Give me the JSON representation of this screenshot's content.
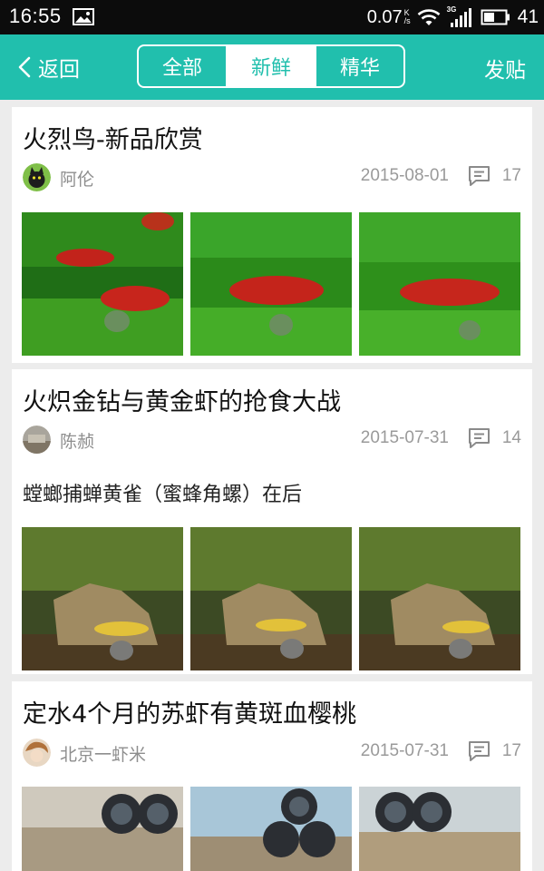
{
  "status_bar": {
    "time": "16:55",
    "speed": "0.07",
    "speed_unit_top": "K",
    "speed_unit_bottom": "/s",
    "network_type": "3G",
    "battery": "41",
    "icons": [
      "image-icon",
      "wifi-icon",
      "signal-icon",
      "battery-icon"
    ]
  },
  "header": {
    "back_label": "返回",
    "tabs": [
      {
        "label": "全部",
        "active": false
      },
      {
        "label": "新鲜",
        "active": true
      },
      {
        "label": "精华",
        "active": false
      }
    ],
    "post_label": "发贴"
  },
  "posts": [
    {
      "title": "火烈鸟-新品欣赏",
      "author": "阿伦",
      "date": "2015-08-01",
      "comments": "17",
      "snippet": "",
      "thumbnails": [
        "shrimp-photo",
        "shrimp-photo",
        "shrimp-photo"
      ]
    },
    {
      "title": "火炽金钻与黄金虾的抢食大战",
      "author": "陈赪",
      "date": "2015-07-31",
      "comments": "14",
      "snippet": "螳螂捕蝉黄雀（蜜蜂角螺）在后",
      "thumbnails": [
        "tank-photo",
        "tank-photo",
        "tank-photo"
      ]
    },
    {
      "title": "定水4个月的苏虾有黄斑血樱桃",
      "author": "北京一虾米",
      "date": "2015-07-31",
      "comments": "17",
      "snippet": "",
      "thumbnails": [
        "tube-photo",
        "tube-photo",
        "tube-photo"
      ]
    }
  ],
  "colors": {
    "accent": "#21bfad",
    "status_bar": "#0c0c0c",
    "background": "#ececec",
    "meta_text": "#9a9a9a"
  }
}
